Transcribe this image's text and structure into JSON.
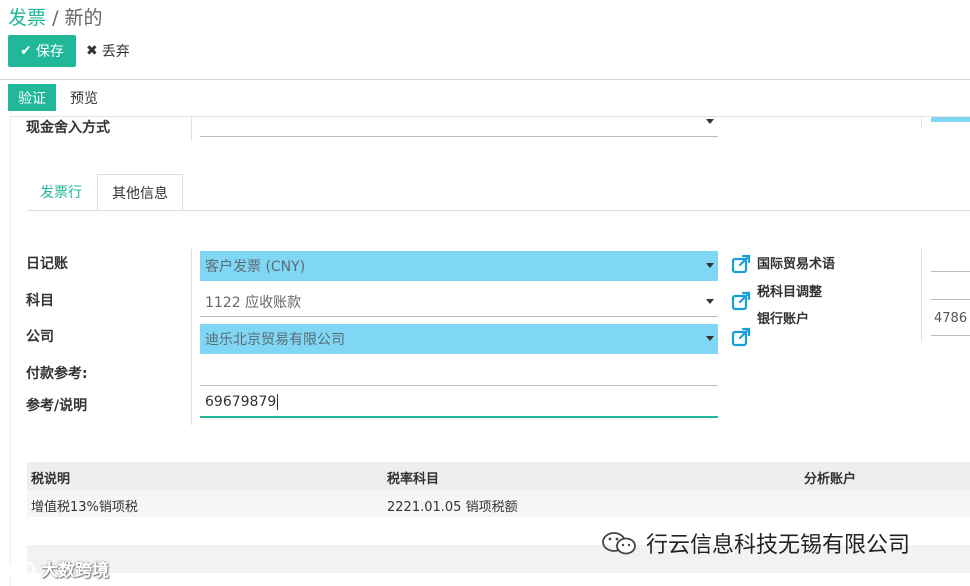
{
  "breadcrumb": {
    "parent": "发票",
    "separator": "/",
    "current": "新的"
  },
  "toolbar": {
    "save_label": "保存",
    "discard_label": "丢弃"
  },
  "statusbar": {
    "validate_label": "验证",
    "preview_label": "预览"
  },
  "fields_top": {
    "cash_rounding_label": "现金舍入方式",
    "cash_rounding_value": ""
  },
  "tabs": [
    {
      "label": "发票行"
    },
    {
      "label": "其他信息"
    }
  ],
  "form": {
    "journal_label": "日记账",
    "journal_value": "客户发票 (CNY)",
    "account_label": "科目",
    "account_value": "1122 应收账款",
    "company_label": "公司",
    "company_value": "迪乐北京贸易有限公司",
    "payment_ref_label": "付款参考:",
    "payment_ref_value": "",
    "reference_label": "参考/说明",
    "reference_value": "69679879"
  },
  "right_fields": {
    "incoterm_label": "国际贸易术语",
    "fiscal_position_label": "税科目调整",
    "bank_account_label": "银行账户",
    "bank_account_value": "4786"
  },
  "tax_table": {
    "headers": [
      "税说明",
      "税率科目",
      "分析账户"
    ],
    "rows": [
      [
        "增值税13%销项税",
        "2221.01.05 销项税额",
        ""
      ]
    ]
  },
  "watermarks": {
    "wechat": "行云信息科技无锡有限公司",
    "corner": "大数跨境"
  },
  "colors": {
    "accent": "#21b799",
    "highlight": "#80d7f5"
  }
}
